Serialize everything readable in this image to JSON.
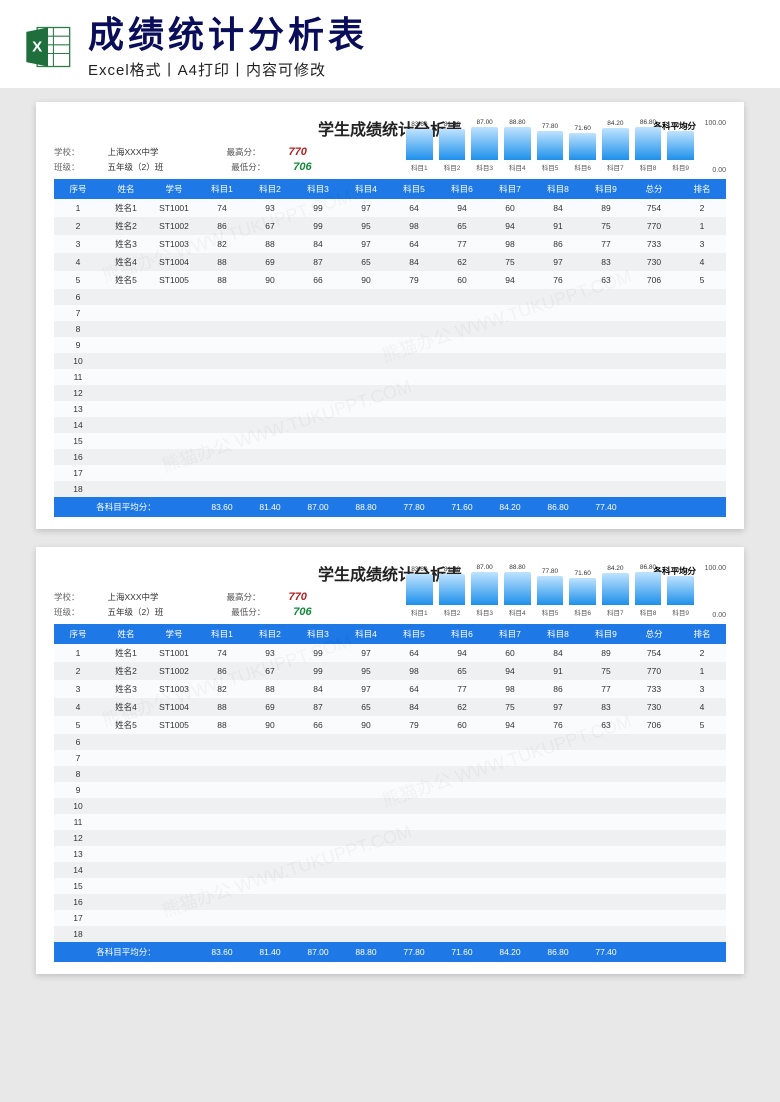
{
  "banner": {
    "title": "成绩统计分析表",
    "subtitle": "Excel格式丨A4打印丨内容可修改"
  },
  "sheet": {
    "title": "学生成绩统计分析表",
    "school_label": "学校：",
    "school_value": "上海XXX中学",
    "class_label": "班级：",
    "class_value": "五年级（2）班",
    "highscore_label": "最高分：",
    "highscore_value": "770",
    "lowscore_label": "最低分：",
    "lowscore_value": "706",
    "chart_title": "各科平均分",
    "axis_max": "100.00",
    "axis_min": "0.00",
    "headers": [
      "序号",
      "姓名",
      "学号",
      "科目1",
      "科目2",
      "科目3",
      "科目4",
      "科目5",
      "科目6",
      "科目7",
      "科目8",
      "科目9",
      "总分",
      "排名"
    ],
    "rows": [
      [
        "1",
        "姓名1",
        "ST1001",
        "74",
        "93",
        "99",
        "97",
        "64",
        "94",
        "60",
        "84",
        "89",
        "754",
        "2"
      ],
      [
        "2",
        "姓名2",
        "ST1002",
        "86",
        "67",
        "99",
        "95",
        "98",
        "65",
        "94",
        "91",
        "75",
        "770",
        "1"
      ],
      [
        "3",
        "姓名3",
        "ST1003",
        "82",
        "88",
        "84",
        "97",
        "64",
        "77",
        "98",
        "86",
        "77",
        "733",
        "3"
      ],
      [
        "4",
        "姓名4",
        "ST1004",
        "88",
        "69",
        "87",
        "65",
        "84",
        "62",
        "75",
        "97",
        "83",
        "730",
        "4"
      ],
      [
        "5",
        "姓名5",
        "ST1005",
        "88",
        "90",
        "66",
        "90",
        "79",
        "60",
        "94",
        "76",
        "63",
        "706",
        "5"
      ],
      [
        "6",
        "",
        "",
        "",
        "",
        "",
        "",
        "",
        "",
        "",
        "",
        "",
        "",
        ""
      ],
      [
        "7",
        "",
        "",
        "",
        "",
        "",
        "",
        "",
        "",
        "",
        "",
        "",
        "",
        ""
      ],
      [
        "8",
        "",
        "",
        "",
        "",
        "",
        "",
        "",
        "",
        "",
        "",
        "",
        "",
        ""
      ],
      [
        "9",
        "",
        "",
        "",
        "",
        "",
        "",
        "",
        "",
        "",
        "",
        "",
        "",
        ""
      ],
      [
        "10",
        "",
        "",
        "",
        "",
        "",
        "",
        "",
        "",
        "",
        "",
        "",
        "",
        ""
      ],
      [
        "11",
        "",
        "",
        "",
        "",
        "",
        "",
        "",
        "",
        "",
        "",
        "",
        "",
        ""
      ],
      [
        "12",
        "",
        "",
        "",
        "",
        "",
        "",
        "",
        "",
        "",
        "",
        "",
        "",
        ""
      ],
      [
        "13",
        "",
        "",
        "",
        "",
        "",
        "",
        "",
        "",
        "",
        "",
        "",
        "",
        ""
      ],
      [
        "14",
        "",
        "",
        "",
        "",
        "",
        "",
        "",
        "",
        "",
        "",
        "",
        "",
        ""
      ],
      [
        "15",
        "",
        "",
        "",
        "",
        "",
        "",
        "",
        "",
        "",
        "",
        "",
        "",
        ""
      ],
      [
        "16",
        "",
        "",
        "",
        "",
        "",
        "",
        "",
        "",
        "",
        "",
        "",
        "",
        ""
      ],
      [
        "17",
        "",
        "",
        "",
        "",
        "",
        "",
        "",
        "",
        "",
        "",
        "",
        "",
        ""
      ],
      [
        "18",
        "",
        "",
        "",
        "",
        "",
        "",
        "",
        "",
        "",
        "",
        "",
        "",
        ""
      ]
    ],
    "footer_label": "各科目平均分：",
    "footer_values": [
      "83.60",
      "81.40",
      "87.00",
      "88.80",
      "77.80",
      "71.60",
      "84.20",
      "86.80",
      "77.40",
      "",
      "",
      ""
    ]
  },
  "chart_data": {
    "type": "bar",
    "title": "各科平均分",
    "ylabel": "",
    "xlabel": "",
    "ylim": [
      0,
      100
    ],
    "categories": [
      "科目1",
      "科目2",
      "科目3",
      "科目4",
      "科目5",
      "科目6",
      "科目7",
      "科目8",
      "科目9"
    ],
    "values": [
      83.6,
      81.4,
      87.0,
      88.8,
      77.8,
      71.6,
      84.2,
      86.8,
      77.4
    ]
  },
  "watermark": "熊猫办公 WWW.TUKUPPT.COM"
}
